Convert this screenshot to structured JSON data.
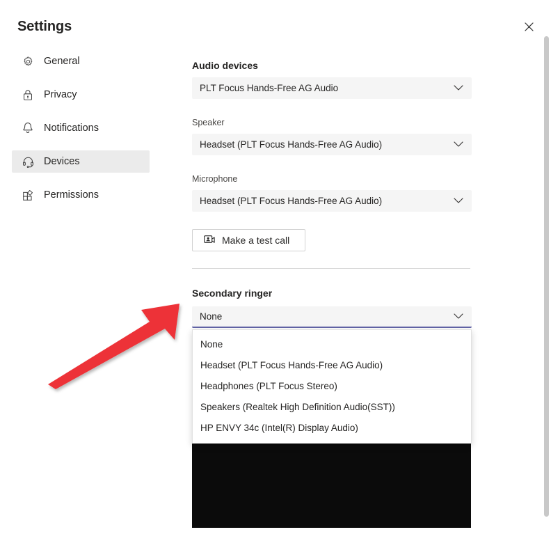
{
  "dialog": {
    "title": "Settings",
    "close_icon": "close-icon"
  },
  "sidebar": {
    "items": [
      {
        "label": "General",
        "icon": "gear-icon",
        "selected": false
      },
      {
        "label": "Privacy",
        "icon": "lock-icon",
        "selected": false
      },
      {
        "label": "Notifications",
        "icon": "bell-icon",
        "selected": false
      },
      {
        "label": "Devices",
        "icon": "headset-icon",
        "selected": true
      },
      {
        "label": "Permissions",
        "icon": "permissions-icon",
        "selected": false
      }
    ]
  },
  "main": {
    "audio_devices": {
      "section_title": "Audio devices",
      "device_value": "PLT Focus Hands-Free AG Audio",
      "speaker_label": "Speaker",
      "speaker_value": "Headset (PLT Focus Hands-Free AG Audio)",
      "microphone_label": "Microphone",
      "microphone_value": "Headset (PLT Focus Hands-Free AG Audio)",
      "chevron_icon": "chevron-down-icon"
    },
    "test_call": {
      "label": "Make a test call",
      "icon": "meet-now-icon"
    },
    "secondary_ringer": {
      "section_title": "Secondary ringer",
      "selected_value": "None",
      "chevron_icon": "chevron-down-icon",
      "options": [
        "None",
        "Headset (PLT Focus Hands-Free AG Audio)",
        "Headphones (PLT Focus Stereo)",
        "Speakers (Realtek High Definition Audio(SST))",
        "HP ENVY 34c (Intel(R) Display Audio)"
      ]
    }
  },
  "annotation": {
    "arrow_color": "#ED3237",
    "arrow_label": "red-pointer-arrow"
  },
  "colors": {
    "accent_focus": "#6264A7",
    "field_background": "#F5F5F5",
    "selected_nav_background": "#EBEBEB",
    "scrollbar_thumb": "#C8C8C8",
    "redacted_block": "#0B0B0B"
  }
}
